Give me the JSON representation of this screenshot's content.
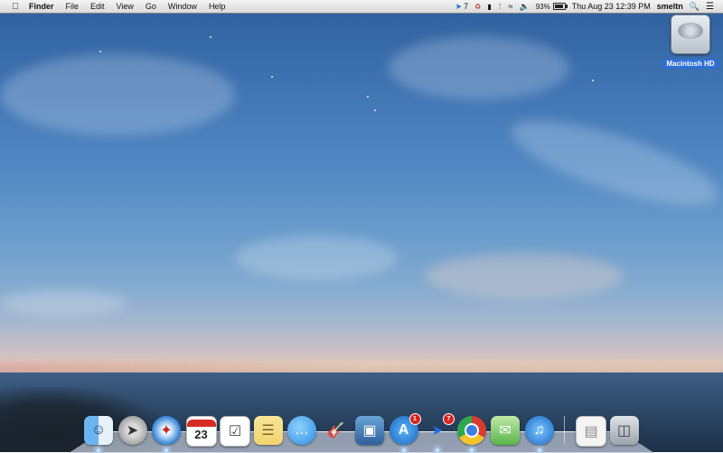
{
  "menubar": {
    "app_name": "Finder",
    "menus": [
      "File",
      "Edit",
      "View",
      "Go",
      "Window",
      "Help"
    ],
    "status": {
      "sparrow_count": "7",
      "battery": "93%",
      "battery_fraction": 0.93,
      "datetime": "Thu Aug 23  12:39 PM",
      "user": "smeltn"
    }
  },
  "desktop": {
    "drive_label": "Macintosh HD"
  },
  "dock": {
    "apps": [
      {
        "name": "Finder",
        "icon": "finder-icon",
        "running": true
      },
      {
        "name": "Launchpad",
        "icon": "rocket-icon",
        "running": false
      },
      {
        "name": "Safari",
        "icon": "compass-icon",
        "running": true
      },
      {
        "name": "Calendar",
        "icon": "calendar-icon",
        "running": false,
        "day": "23"
      },
      {
        "name": "Reminders",
        "icon": "checklist-icon",
        "running": false
      },
      {
        "name": "Notes",
        "icon": "notepad-icon",
        "running": false
      },
      {
        "name": "Messages",
        "icon": "chat-bubbles-icon",
        "running": false
      },
      {
        "name": "GarageBand",
        "icon": "guitar-icon",
        "running": false
      },
      {
        "name": "iPhoto",
        "icon": "photo-camera-icon",
        "running": false
      },
      {
        "name": "App Store",
        "icon": "app-store-icon",
        "running": true,
        "badge": "1"
      },
      {
        "name": "Sparrow",
        "icon": "paper-plane-icon",
        "running": true,
        "badge": "7"
      },
      {
        "name": "Chrome",
        "icon": "chrome-icon",
        "running": true
      },
      {
        "name": "iMessage",
        "icon": "speech-bubble-icon",
        "running": false
      },
      {
        "name": "iTunes",
        "icon": "music-note-icon",
        "running": true
      }
    ],
    "stack": {
      "name": "Documents",
      "icon": "documents-stack-icon"
    },
    "trash": {
      "name": "Trash",
      "icon": "trash-icon"
    }
  }
}
